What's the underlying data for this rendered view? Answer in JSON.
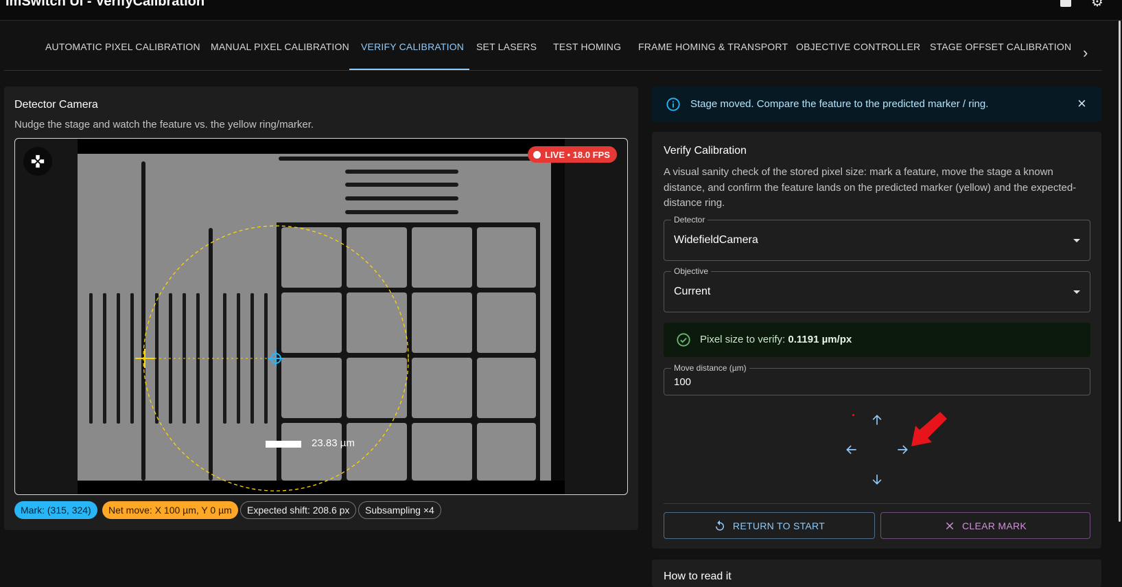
{
  "app": {
    "title": "ImSwitch UI - VerifyCalibration"
  },
  "tabs": [
    {
      "label": "AUTOMATIC PIXEL CALIBRATION",
      "active": false
    },
    {
      "label": "MANUAL PIXEL CALIBRATION",
      "active": false
    },
    {
      "label": "VERIFY CALIBRATION",
      "active": true
    },
    {
      "label": "SET LASERS",
      "active": false
    },
    {
      "label": "TEST HOMING",
      "active": false
    },
    {
      "label": "FRAME HOMING & TRANSPORT",
      "active": false
    },
    {
      "label": "OBJECTIVE CONTROLLER",
      "active": false
    },
    {
      "label": "STAGE OFFSET CALIBRATION",
      "active": false
    }
  ],
  "camera": {
    "title": "Detector Camera",
    "subtitle": "Nudge the stage and watch the feature vs. the yellow ring/marker.",
    "live_badge": "LIVE • 18.0 FPS",
    "scale_bar_label": "23.83 µm",
    "chips": {
      "mark": "Mark: (315, 324)",
      "net_move": "Net move: X 100 µm, Y 0 µm",
      "expected_shift": "Expected shift: 208.6 px",
      "subsampling": "Subsampling ×4"
    }
  },
  "alert": {
    "message": "Stage moved. Compare the feature to the predicted marker / ring."
  },
  "verify": {
    "title": "Verify Calibration",
    "description": "A visual sanity check of the stored pixel size: mark a feature, move the stage a known distance, and confirm the feature lands on the predicted marker (yellow) and the expected-distance ring.",
    "detector": {
      "label": "Detector",
      "value": "WidefieldCamera"
    },
    "objective": {
      "label": "Objective",
      "value": "Current"
    },
    "pixel_size": {
      "label": "Pixel size to verify: ",
      "value": "0.1191 µm/px"
    },
    "move_distance": {
      "label": "Move distance (µm)",
      "value": "100"
    },
    "return_button": "RETURN TO START",
    "clear_button": "CLEAR MARK"
  },
  "how_to": {
    "title": "How to read it"
  },
  "colors": {
    "accent": "#90caf9",
    "live": "#e53935",
    "marker": "#ffd600",
    "feature": "#29b6f6",
    "annotation_arrow": "#e8141b"
  }
}
